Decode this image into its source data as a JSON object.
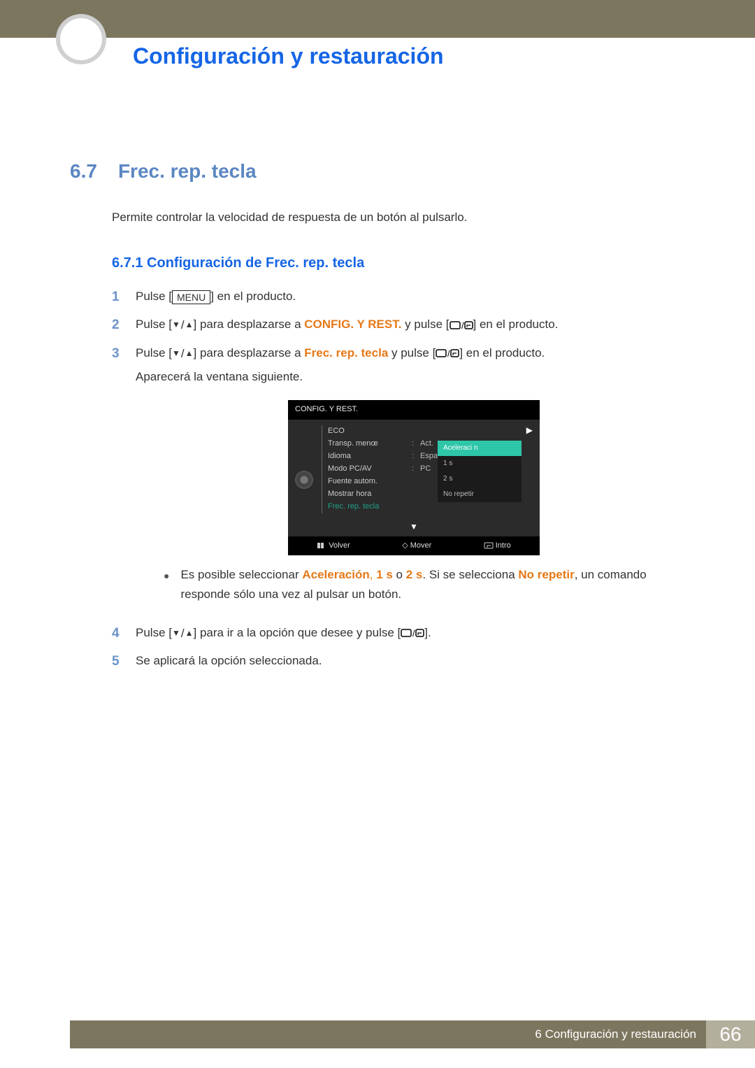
{
  "chapter_title": "Configuración y restauración",
  "section": {
    "num": "6.7",
    "title": "Frec. rep. tecla"
  },
  "intro": "Permite controlar la velocidad de respuesta de un botón al pulsarlo.",
  "subsection": "6.7.1  Configuración de Frec. rep. tecla",
  "steps": {
    "s1": {
      "n": "1",
      "a": "Pulse [",
      "menu": "MENU",
      "b": "] en el producto."
    },
    "s2": {
      "n": "2",
      "a": "Pulse [",
      "mid": "] para desplazarse a ",
      "tgt": "CONFIG. Y REST.",
      "after": " y pulse [",
      "end": "] en el producto."
    },
    "s3": {
      "n": "3",
      "a": "Pulse [",
      "mid": "] para desplazarse a ",
      "tgt": "Frec. rep. tecla",
      "after": " y pulse [",
      "end": "] en el producto.",
      "note": "Aparecerá la ventana siguiente."
    },
    "bullet": {
      "a": "Es posible seleccionar ",
      "o1": "Aceleración",
      "c1": ", ",
      "o2": "1 s",
      "c2": " o ",
      "o3": "2 s",
      "c3": ". Si se selecciona ",
      "o4": "No repetir",
      "c4": ", un comando responde sólo una vez al pulsar un botón."
    },
    "s4": {
      "n": "4",
      "a": "Pulse [",
      "mid": "] para ir a la opción que desee y pulse [",
      "end": "]."
    },
    "s5": {
      "n": "5",
      "a": "Se aplicará la opción seleccionada."
    }
  },
  "osd": {
    "title": "CONFIG. Y REST.",
    "items": [
      {
        "label": "ECO",
        "val": ""
      },
      {
        "label": "Transp. menœ",
        "val": "Act."
      },
      {
        "label": "Idioma",
        "val": "Espaæol"
      },
      {
        "label": "Modo PC/AV",
        "val": "PC"
      },
      {
        "label": "Fuente autom.",
        "val": ""
      },
      {
        "label": "Mostrar hora",
        "val": ""
      },
      {
        "label": "Frec. rep. tecla",
        "val": "",
        "sel": true
      }
    ],
    "popup": [
      "Aceleraci n",
      "1 s",
      "2 s",
      "No repetir"
    ],
    "footer": {
      "back": "Volver",
      "move": "Mover",
      "enter": "Intro"
    }
  },
  "footer": {
    "text": "6 Configuración y restauración",
    "page": "66"
  }
}
